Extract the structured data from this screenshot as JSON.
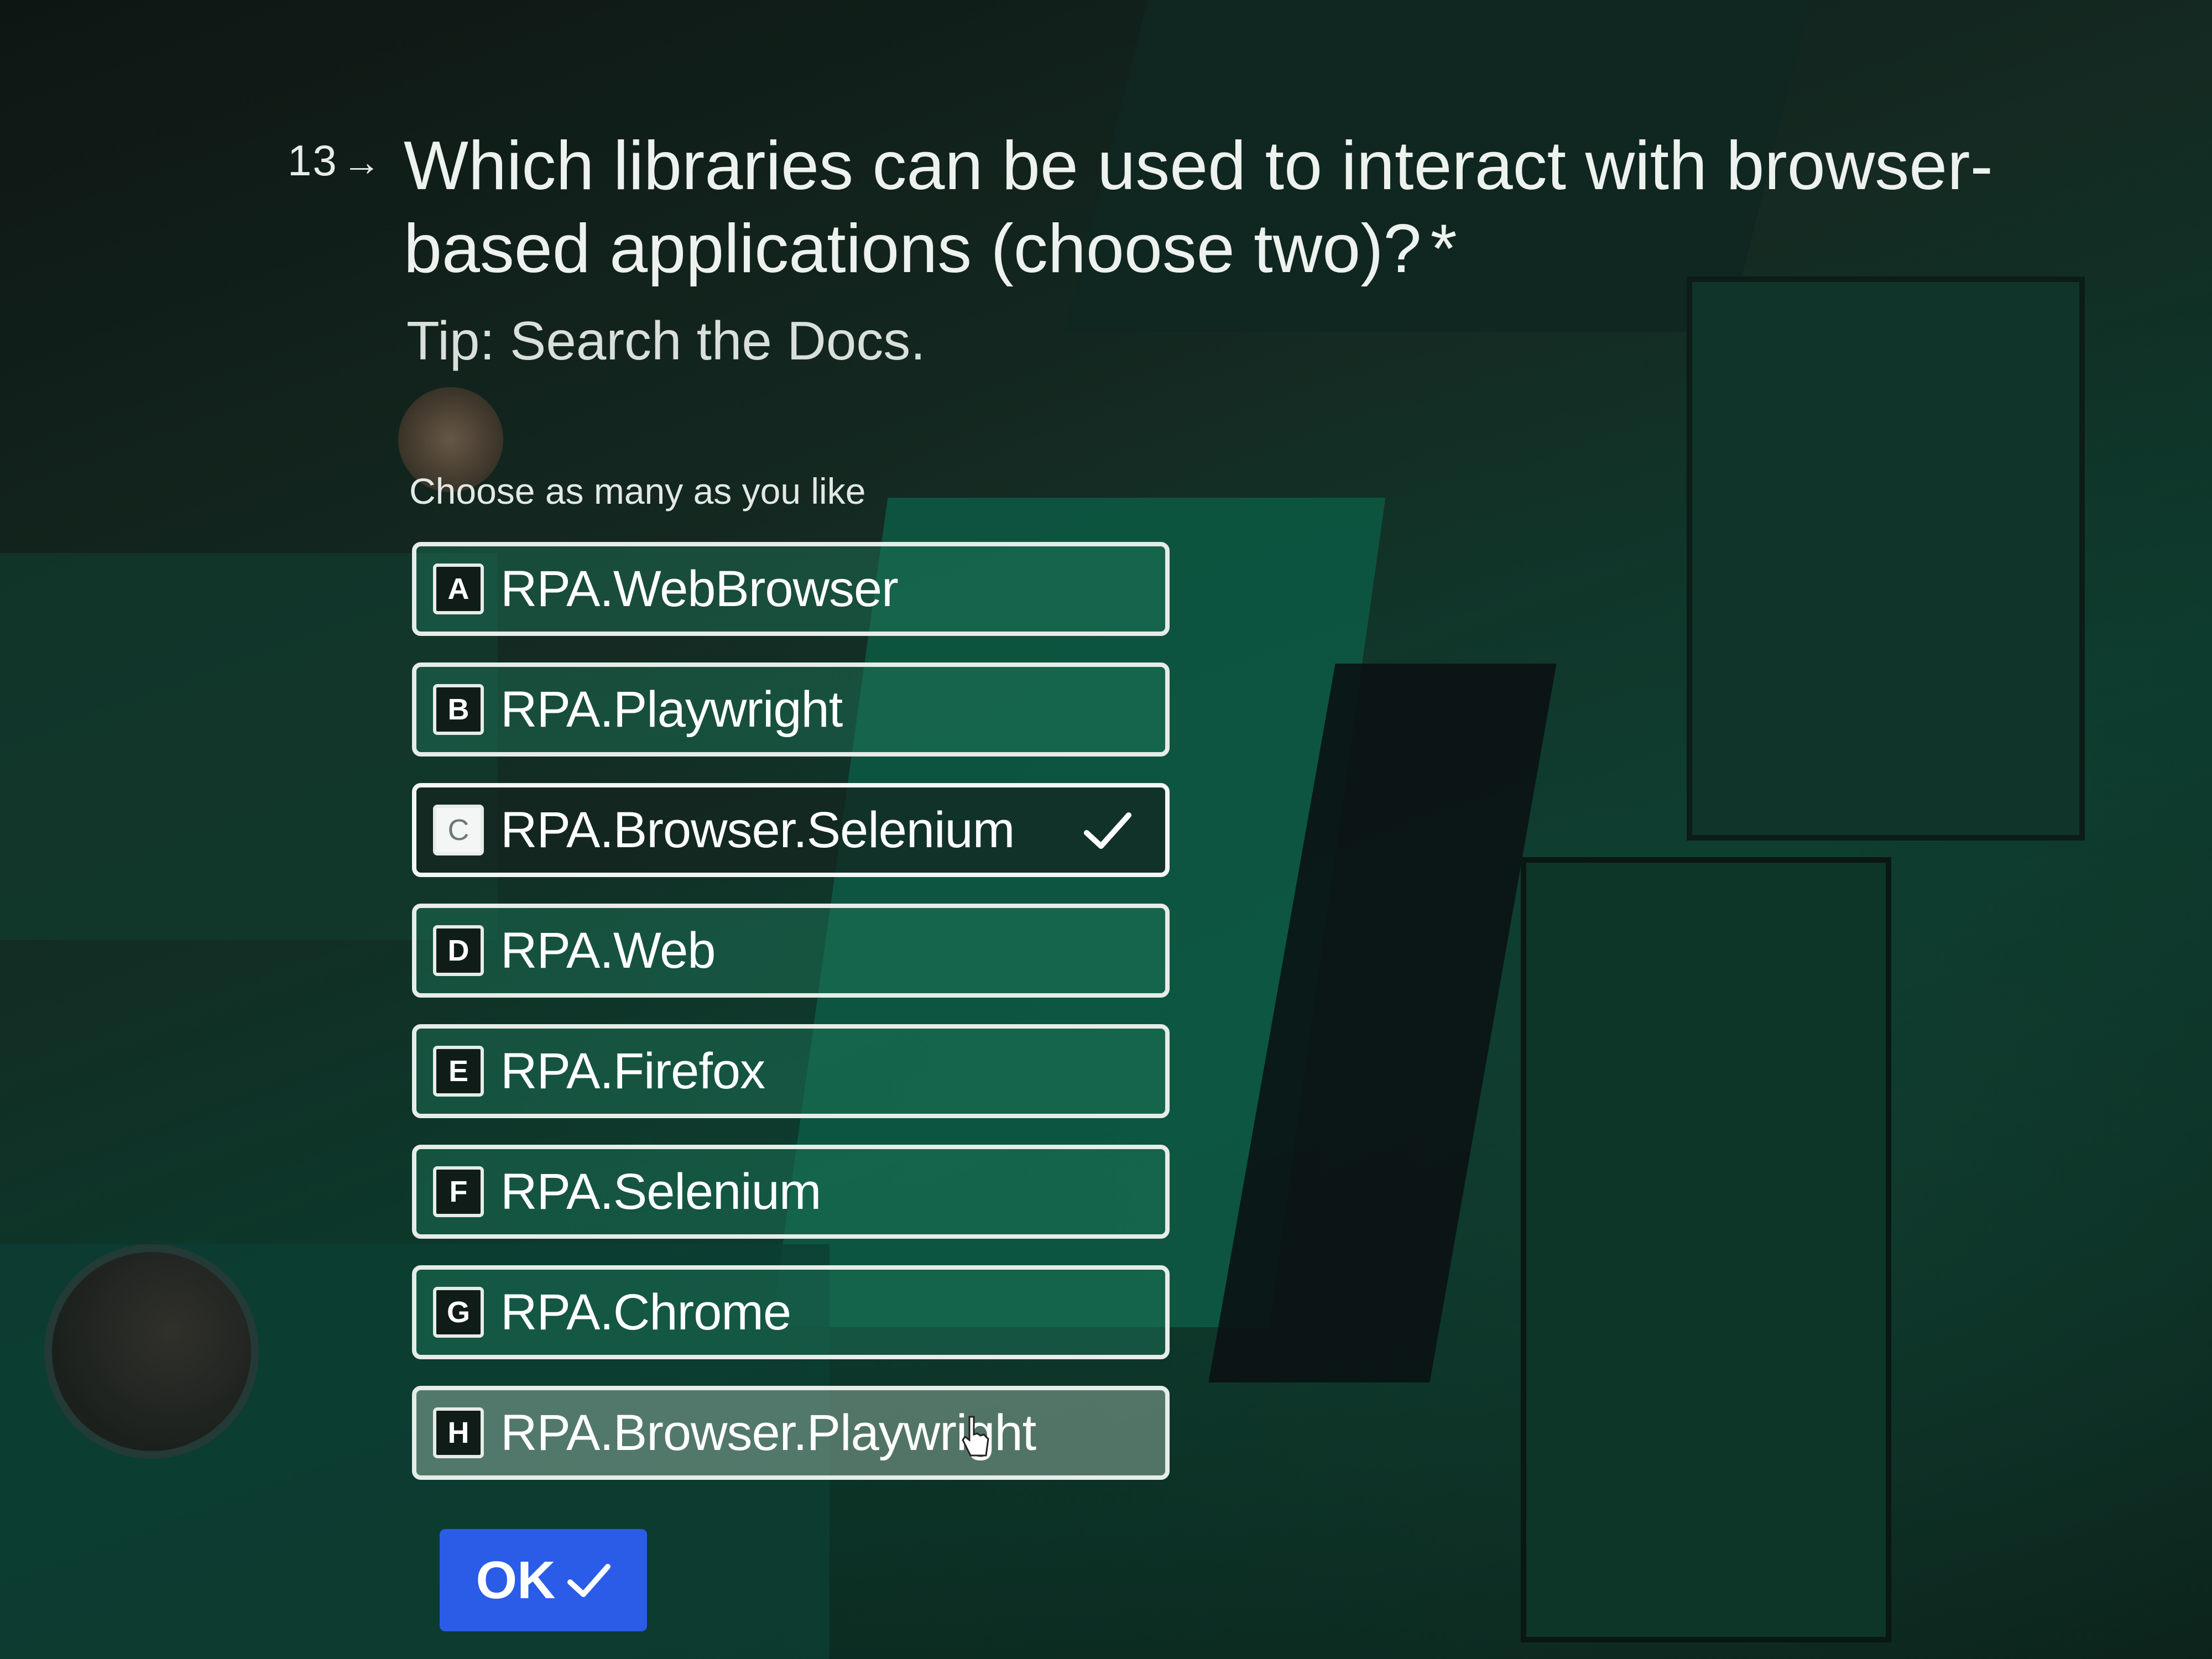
{
  "question": {
    "number": "13",
    "text": "Which libraries can be used to interact with browser-based applications (choose two)?",
    "required_marker": "*",
    "tip": "Tip: Search the Docs."
  },
  "choose_hint": "Choose as many as you like",
  "options": [
    {
      "key": "A",
      "label": "RPA.WebBrowser",
      "selected": false
    },
    {
      "key": "B",
      "label": "RPA.Playwright",
      "selected": false
    },
    {
      "key": "C",
      "label": "RPA.Browser.Selenium",
      "selected": true
    },
    {
      "key": "D",
      "label": "RPA.Web",
      "selected": false
    },
    {
      "key": "E",
      "label": "RPA.Firefox",
      "selected": false
    },
    {
      "key": "F",
      "label": "RPA.Selenium",
      "selected": false
    },
    {
      "key": "G",
      "label": "RPA.Chrome",
      "selected": false
    },
    {
      "key": "H",
      "label": "RPA.Browser.Playwright",
      "selected": false,
      "hovered": true
    }
  ],
  "ok_button": {
    "label": "OK"
  },
  "colors": {
    "button_blue": "#2a5ce8",
    "option_fill": "#1e785a",
    "selected_fill": "#14231e"
  }
}
